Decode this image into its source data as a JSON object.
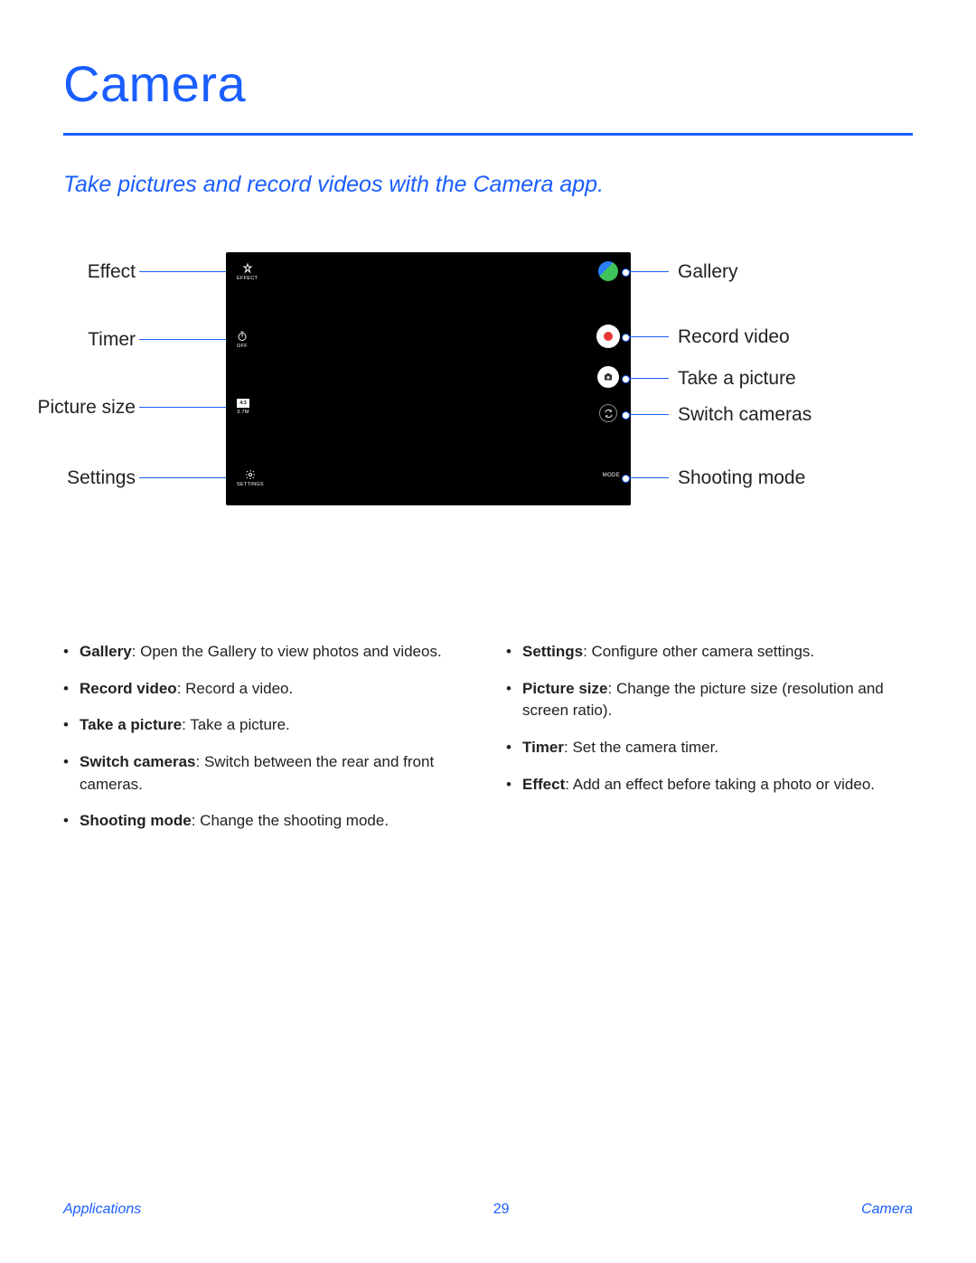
{
  "title": "Camera",
  "subtitle": "Take pictures and record videos with the Camera app.",
  "labels_left": {
    "effect": "Effect",
    "timer": "Timer",
    "picture_size": "Picture size",
    "settings": "Settings"
  },
  "labels_right": {
    "gallery": "Gallery",
    "record_video": "Record video",
    "take_picture": "Take a picture",
    "switch_cameras": "Switch cameras",
    "shooting_mode": "Shooting mode"
  },
  "screen_icons": {
    "effect_caption": "EFFECT",
    "timer_caption": "OFF",
    "ratio_text": "4:3",
    "size_caption": "3.7M",
    "settings_caption": "SETTINGS",
    "mode_caption": "MODE"
  },
  "bullets_left": [
    {
      "term": "Gallery",
      "desc": ": Open the Gallery to view photos and videos."
    },
    {
      "term": "Record video",
      "desc": ": Record a video."
    },
    {
      "term": "Take a picture",
      "desc": ": Take a picture."
    },
    {
      "term": "Switch cameras",
      "desc": ": Switch between the rear and front cameras."
    },
    {
      "term": "Shooting mode",
      "desc": ": Change the shooting mode."
    }
  ],
  "bullets_right": [
    {
      "term": "Settings",
      "desc": ": Configure other camera settings."
    },
    {
      "term": "Picture size",
      "desc": ": Change the picture size (resolution and screen ratio)."
    },
    {
      "term": "Timer",
      "desc": ": Set the camera timer."
    },
    {
      "term": "Effect",
      "desc": ": Add an effect before taking a photo or video."
    }
  ],
  "footer": {
    "left": "Applications",
    "center": "29",
    "right": "Camera"
  }
}
